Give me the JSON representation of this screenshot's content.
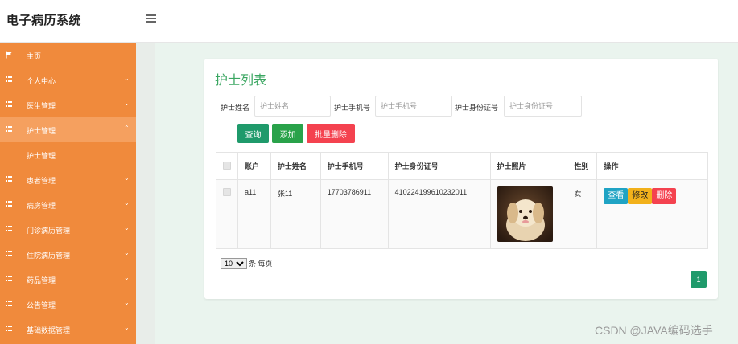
{
  "header": {
    "title": "电子病历系统"
  },
  "sidebar": {
    "items": [
      {
        "label": "主页",
        "icon": "flag-icon",
        "chevron": ""
      },
      {
        "label": "个人中心",
        "icon": "grid-icon",
        "chevron": "⌄"
      },
      {
        "label": "医生管理",
        "icon": "grid-icon",
        "chevron": "⌄"
      },
      {
        "label": "护士管理",
        "icon": "grid-icon",
        "chevron": "⌃"
      },
      {
        "label": "护士管理"
      },
      {
        "label": "患者管理",
        "icon": "grid-icon",
        "chevron": "⌄"
      },
      {
        "label": "病房管理",
        "icon": "grid-icon",
        "chevron": "⌄"
      },
      {
        "label": "门诊病历管理",
        "icon": "grid-icon",
        "chevron": "⌄"
      },
      {
        "label": "住院病历管理",
        "icon": "grid-icon",
        "chevron": "⌄"
      },
      {
        "label": "药品管理",
        "icon": "grid-icon",
        "chevron": "⌄"
      },
      {
        "label": "公告管理",
        "icon": "grid-icon",
        "chevron": "⌄"
      },
      {
        "label": "基础数据管理",
        "icon": "grid-icon",
        "chevron": "⌄"
      }
    ]
  },
  "main": {
    "title": "护士列表",
    "search": {
      "name_label": "护士姓名",
      "name_placeholder": "护士姓名",
      "name_value": "",
      "phone_label": "护士手机号",
      "phone_placeholder": "护士手机号",
      "phone_value": "",
      "id_label": "护士身份证号",
      "id_placeholder": "护士身份证号",
      "id_value": ""
    },
    "buttons": {
      "query": "查询",
      "add": "添加",
      "bulk_delete": "批量删除"
    },
    "table": {
      "headers": [
        "账户",
        "护士姓名",
        "护士手机号",
        "护士身份证号",
        "护士照片",
        "性别",
        "操作"
      ],
      "rows": [
        {
          "account": "a11",
          "name": "张11",
          "phone": "17703786911",
          "id_number": "410224199610232011",
          "gender": "女",
          "view": "查看",
          "edit": "修改",
          "delete": "删除"
        }
      ]
    },
    "pager": {
      "size_option": "10",
      "size_suffix": "条 每页",
      "current_page": "1"
    }
  },
  "watermark": "CSDN @JAVA编码选手",
  "colors": {
    "sidebar": "#f08a3c",
    "title": "#3aa661",
    "primary": "#1f9a6b",
    "danger": "#f4424f",
    "warning": "#f2b11b",
    "info": "#1fa3c4"
  }
}
